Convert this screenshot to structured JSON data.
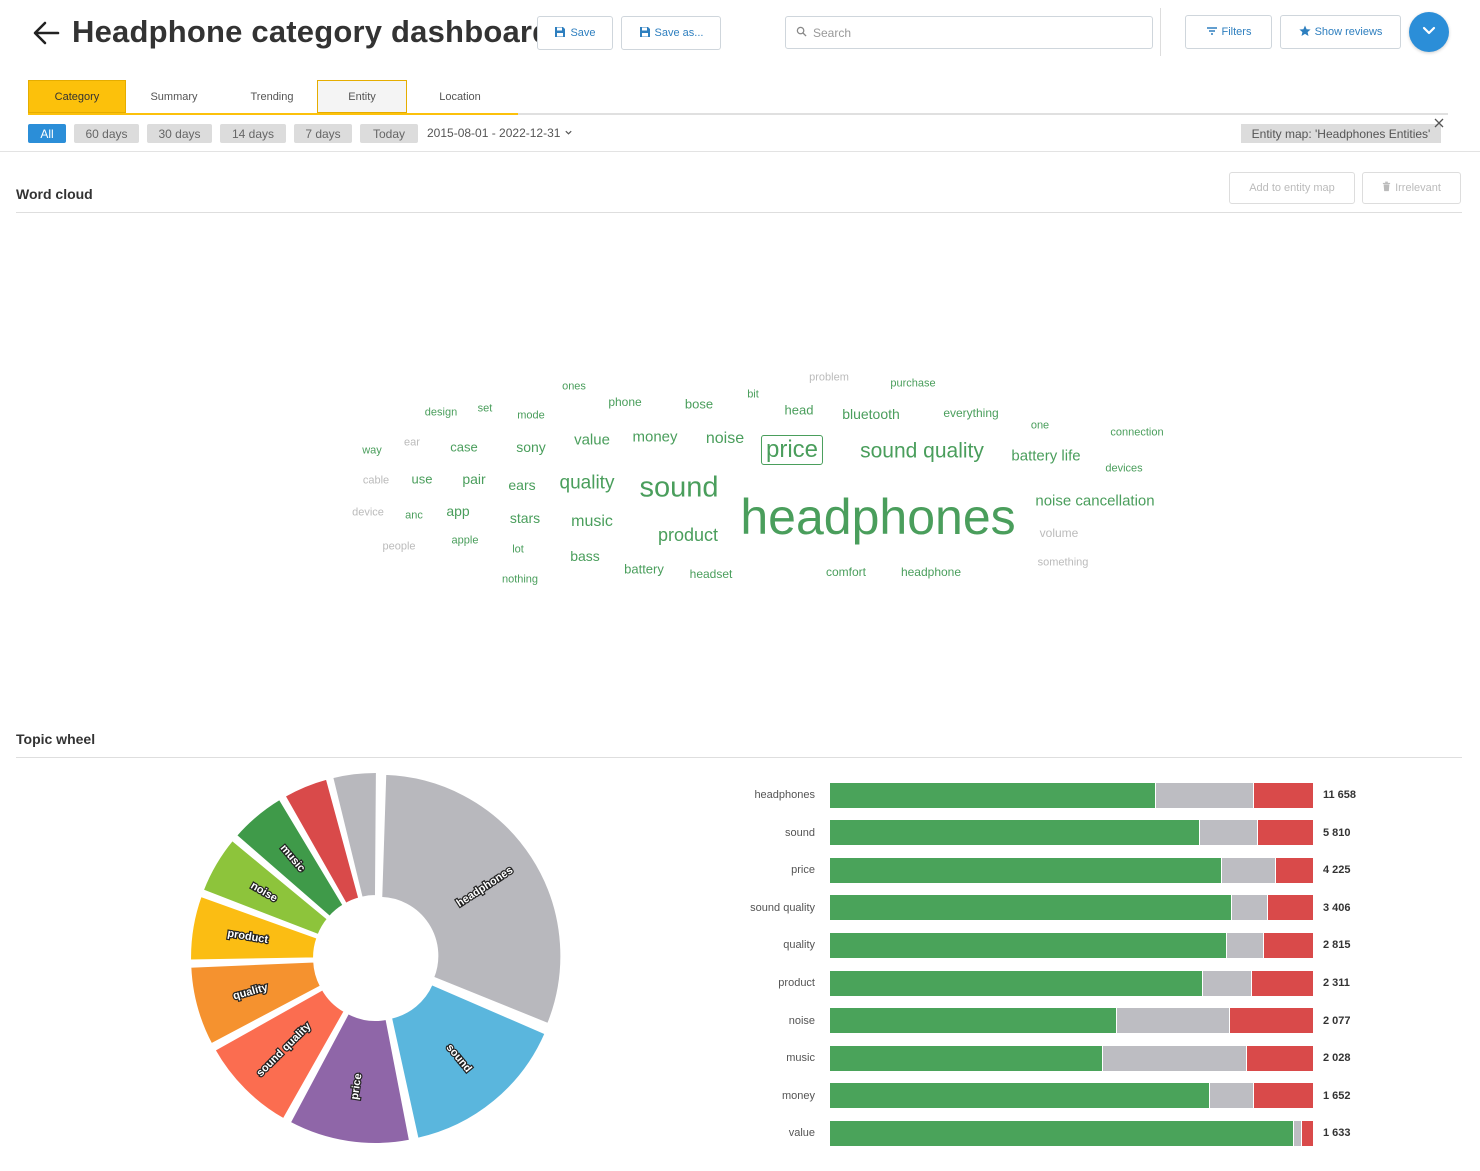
{
  "header": {
    "title": "Headphone category dashboard",
    "save_label": "Save",
    "save_as_label": "Save as...",
    "search_placeholder": "Search",
    "filters_label": "Filters",
    "show_reviews_label": "Show reviews"
  },
  "tabs": [
    {
      "label": "Category"
    },
    {
      "label": "Summary"
    },
    {
      "label": "Trending"
    },
    {
      "label": "Entity"
    },
    {
      "label": "Location"
    }
  ],
  "date_filters": [
    "All",
    "60 days",
    "30 days",
    "14 days",
    "7 days",
    "Today"
  ],
  "date_range": "2015-08-01 - 2022-12-31",
  "entity_map_label": "Entity map: 'Headphones Entities'",
  "word_cloud": {
    "title": "Word cloud",
    "add_to_entity_map_label": "Add to entity map",
    "irrelevant_label": "Irrelevant",
    "words": [
      {
        "text": "headphones",
        "tone": "green"
      },
      {
        "text": "sound",
        "tone": "green"
      },
      {
        "text": "price",
        "tone": "green"
      },
      {
        "text": "sound quality",
        "tone": "green"
      },
      {
        "text": "quality",
        "tone": "green"
      },
      {
        "text": "product",
        "tone": "green"
      },
      {
        "text": "noise cancellation",
        "tone": "green"
      },
      {
        "text": "battery life",
        "tone": "green"
      },
      {
        "text": "music",
        "tone": "green"
      },
      {
        "text": "noise",
        "tone": "green"
      },
      {
        "text": "money",
        "tone": "green"
      },
      {
        "text": "value",
        "tone": "green"
      },
      {
        "text": "bluetooth",
        "tone": "green"
      },
      {
        "text": "bass",
        "tone": "green"
      },
      {
        "text": "battery",
        "tone": "green"
      },
      {
        "text": "sony",
        "tone": "green"
      },
      {
        "text": "stars",
        "tone": "green"
      },
      {
        "text": "ears",
        "tone": "green"
      },
      {
        "text": "pair",
        "tone": "green"
      },
      {
        "text": "case",
        "tone": "green"
      },
      {
        "text": "app",
        "tone": "green"
      },
      {
        "text": "use",
        "tone": "green"
      },
      {
        "text": "head",
        "tone": "green"
      },
      {
        "text": "bose",
        "tone": "green"
      },
      {
        "text": "headset",
        "tone": "green"
      },
      {
        "text": "comfort",
        "tone": "green"
      },
      {
        "text": "headphone",
        "tone": "green"
      },
      {
        "text": "phone",
        "tone": "green"
      },
      {
        "text": "everything",
        "tone": "green"
      },
      {
        "text": "connection",
        "tone": "green"
      },
      {
        "text": "devices",
        "tone": "green"
      },
      {
        "text": "purchase",
        "tone": "green"
      },
      {
        "text": "mode",
        "tone": "green"
      },
      {
        "text": "set",
        "tone": "green"
      },
      {
        "text": "design",
        "tone": "green"
      },
      {
        "text": "ones",
        "tone": "green"
      },
      {
        "text": "bit",
        "tone": "green"
      },
      {
        "text": "one",
        "tone": "green"
      },
      {
        "text": "way",
        "tone": "green"
      },
      {
        "text": "anc",
        "tone": "green"
      },
      {
        "text": "apple",
        "tone": "green"
      },
      {
        "text": "lot",
        "tone": "green"
      },
      {
        "text": "nothing",
        "tone": "green"
      },
      {
        "text": "problem",
        "tone": "grey"
      },
      {
        "text": "ear",
        "tone": "grey"
      },
      {
        "text": "cable",
        "tone": "grey"
      },
      {
        "text": "device",
        "tone": "grey"
      },
      {
        "text": "people",
        "tone": "grey"
      },
      {
        "text": "volume",
        "tone": "grey"
      },
      {
        "text": "something",
        "tone": "grey"
      }
    ]
  },
  "topic_wheel": {
    "title": "Topic wheel"
  },
  "colors": {
    "accent_yellow": "#fcc10b",
    "accent_blue": "#2b8ed8",
    "positive": "#4aa35a",
    "neutral": "#bdbdc2",
    "negative": "#d94a4a",
    "word_green": "#4a9e5c",
    "word_grey": "#bbbbbb"
  },
  "chart_data": [
    {
      "type": "pie",
      "chart": "topic-wheel",
      "categories": [
        "headphones",
        "sound",
        "price",
        "sound quality",
        "quality",
        "product",
        "noise",
        "music",
        "money",
        "value"
      ],
      "values": [
        11658,
        5810,
        4225,
        3406,
        2815,
        2311,
        2077,
        2028,
        1652,
        1633
      ],
      "colors": [
        "#b8b8bd",
        "#5ab6dd",
        "#8f66a8",
        "#fb6d50",
        "#f5922f",
        "#fbbd13",
        "#8dc43b",
        "#3f9a49",
        "#d94a4a",
        "#b8b8bd"
      ],
      "labeled": [
        "headphones",
        "sound",
        "price",
        "sound quality",
        "quality",
        "product",
        "noise",
        "music"
      ]
    },
    {
      "type": "bar",
      "orientation": "horizontal",
      "stacked": true,
      "categories": [
        "headphones",
        "sound",
        "price",
        "sound quality",
        "quality",
        "product",
        "noise",
        "music",
        "money",
        "value"
      ],
      "totals": [
        "11 658",
        "5 810",
        "4 225",
        "3 406",
        "2 815",
        "2 311",
        "2 077",
        "2 028",
        "1 652",
        "1 633"
      ],
      "series": [
        {
          "sentiment": "positive",
          "values": [
            0.675,
            0.766,
            0.811,
            0.833,
            0.821,
            0.773,
            0.594,
            0.566,
            0.787,
            0.96
          ]
        },
        {
          "sentiment": "neutral",
          "values": [
            0.203,
            0.121,
            0.113,
            0.073,
            0.077,
            0.101,
            0.235,
            0.297,
            0.09,
            0.017
          ]
        },
        {
          "sentiment": "negative",
          "values": [
            0.122,
            0.113,
            0.076,
            0.094,
            0.102,
            0.126,
            0.171,
            0.137,
            0.123,
            0.023
          ]
        }
      ]
    }
  ]
}
